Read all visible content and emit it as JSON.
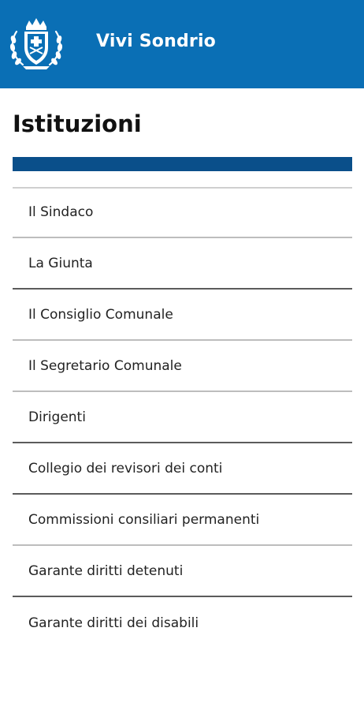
{
  "header": {
    "app_title": "Vivi Sondrio",
    "logo_icon": "city-crest-icon",
    "background_color": "#0a6fb5"
  },
  "page": {
    "title": "Istituzioni",
    "accent_bar_color": "#0a4f8a"
  },
  "menu": {
    "items": [
      {
        "label": "Il Sindaco"
      },
      {
        "label": "La Giunta"
      },
      {
        "label": "Il Consiglio Comunale"
      },
      {
        "label": "Il Segretario Comunale"
      },
      {
        "label": "Dirigenti"
      },
      {
        "label": "Collegio dei revisori dei conti"
      },
      {
        "label": "Commissioni consiliari permanenti"
      },
      {
        "label": "Garante diritti detenuti"
      },
      {
        "label": "Garante diritti dei disabili"
      }
    ]
  }
}
